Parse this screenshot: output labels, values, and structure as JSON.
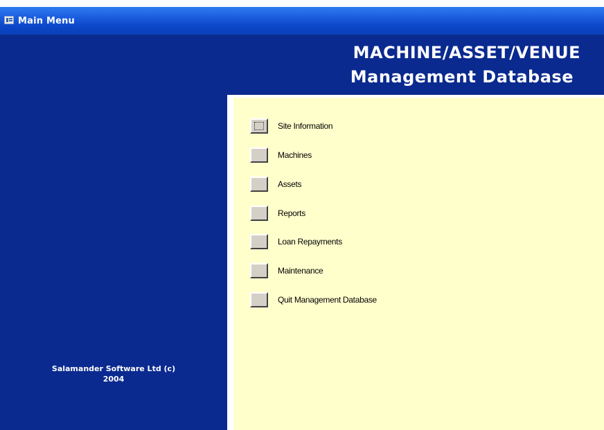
{
  "window": {
    "title": "Main Menu",
    "icon": "access-form-icon"
  },
  "header": {
    "title_line1": "MACHINE/ASSET/VENUE",
    "title_line2": "Management Database"
  },
  "sidebar": {
    "copyright_line1": "Salamander Software Ltd (c)",
    "copyright_line2": "2004"
  },
  "menu": {
    "items": [
      {
        "label": "Site Information"
      },
      {
        "label": "Machines"
      },
      {
        "label": "Assets"
      },
      {
        "label": "Reports"
      },
      {
        "label": "Loan Repayments"
      },
      {
        "label": "Maintenance"
      },
      {
        "label": "Quit Management Database"
      }
    ]
  },
  "colors": {
    "titlebar_blue": "#0b47c8",
    "header_navy": "#0a2a8f",
    "content_yellow": "#ffffcc",
    "button_gray": "#d4d0c8"
  }
}
